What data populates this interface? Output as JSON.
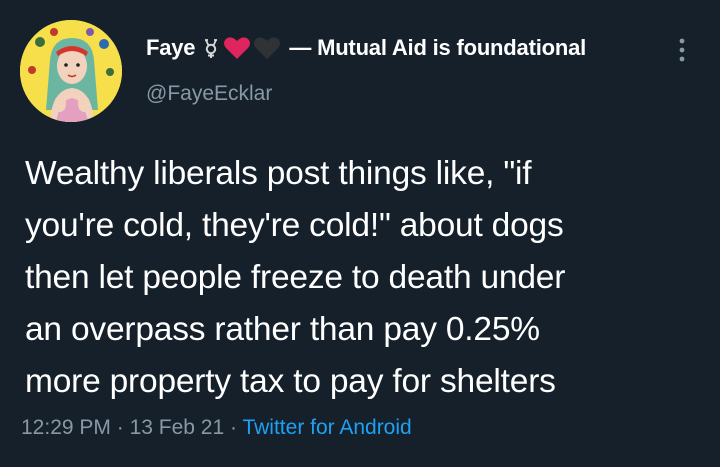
{
  "author": {
    "display_name": "Faye",
    "emoji_icons": [
      "transgender-symbol-icon",
      "red-heart-icon",
      "black-heart-icon"
    ],
    "name_suffix": "— Mutual Aid is foundational",
    "handle": "@FayeEcklar"
  },
  "tweet": {
    "lines": [
      "Wealthy liberals post things like, \"if",
      "you're cold, they're cold!\" about dogs",
      "then let people freeze to death under",
      "an overpass rather than pay 0.25%",
      "more property tax to pay for shelters"
    ]
  },
  "meta": {
    "time": "12:29 PM",
    "separator": "·",
    "date": "13 Feb 21",
    "source": "Twitter for Android"
  },
  "colors": {
    "background": "#15202b",
    "primary_text": "#ffffff",
    "secondary_text": "#8899a6",
    "link": "#1da1f2",
    "heart": "#e0245e"
  }
}
